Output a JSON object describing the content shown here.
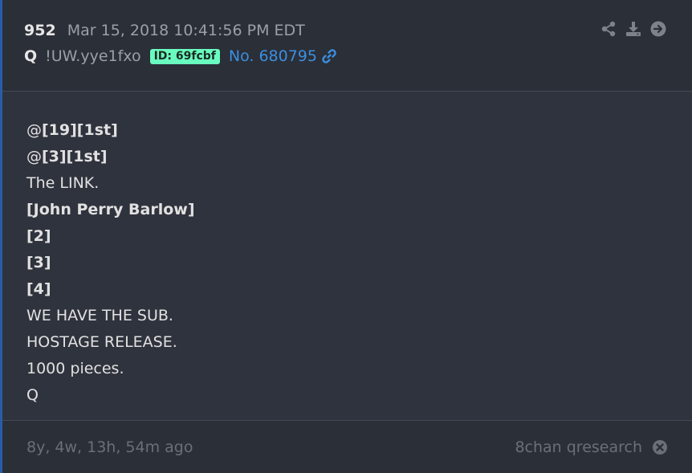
{
  "header": {
    "post_index": "952",
    "timestamp": "Mar 15, 2018 10:41:56 PM EDT",
    "name": "Q",
    "tripcode": "!UW.yye1fxo",
    "id_badge": "ID: 69fcbf",
    "post_number": "No. 680795",
    "id_color": "#69fcbf",
    "link_color": "#3b8fe0",
    "icons": [
      "share-icon",
      "download-icon",
      "arrow-right-circle-icon",
      "link-icon"
    ]
  },
  "body": {
    "lines": [
      {
        "text": "@[19][1st]",
        "bold_part": "[19][1st]",
        "prefix": "@"
      },
      {
        "text": "@[3][1st]",
        "bold_part": "[3][1st]",
        "prefix": "@"
      },
      {
        "text": "The LINK."
      },
      {
        "text": "[John Perry Barlow]"
      },
      {
        "text": "[2]"
      },
      {
        "text": "[3]"
      },
      {
        "text": "[4]"
      },
      {
        "text": "WE HAVE THE SUB."
      },
      {
        "text": "HOSTAGE RELEASE."
      },
      {
        "text": "1000 pieces."
      },
      {
        "text": "Q"
      }
    ]
  },
  "footer": {
    "age": "8y, 4w, 13h, 54m ago",
    "source": "8chan qresearch",
    "icons": [
      "close-circle-icon"
    ]
  }
}
